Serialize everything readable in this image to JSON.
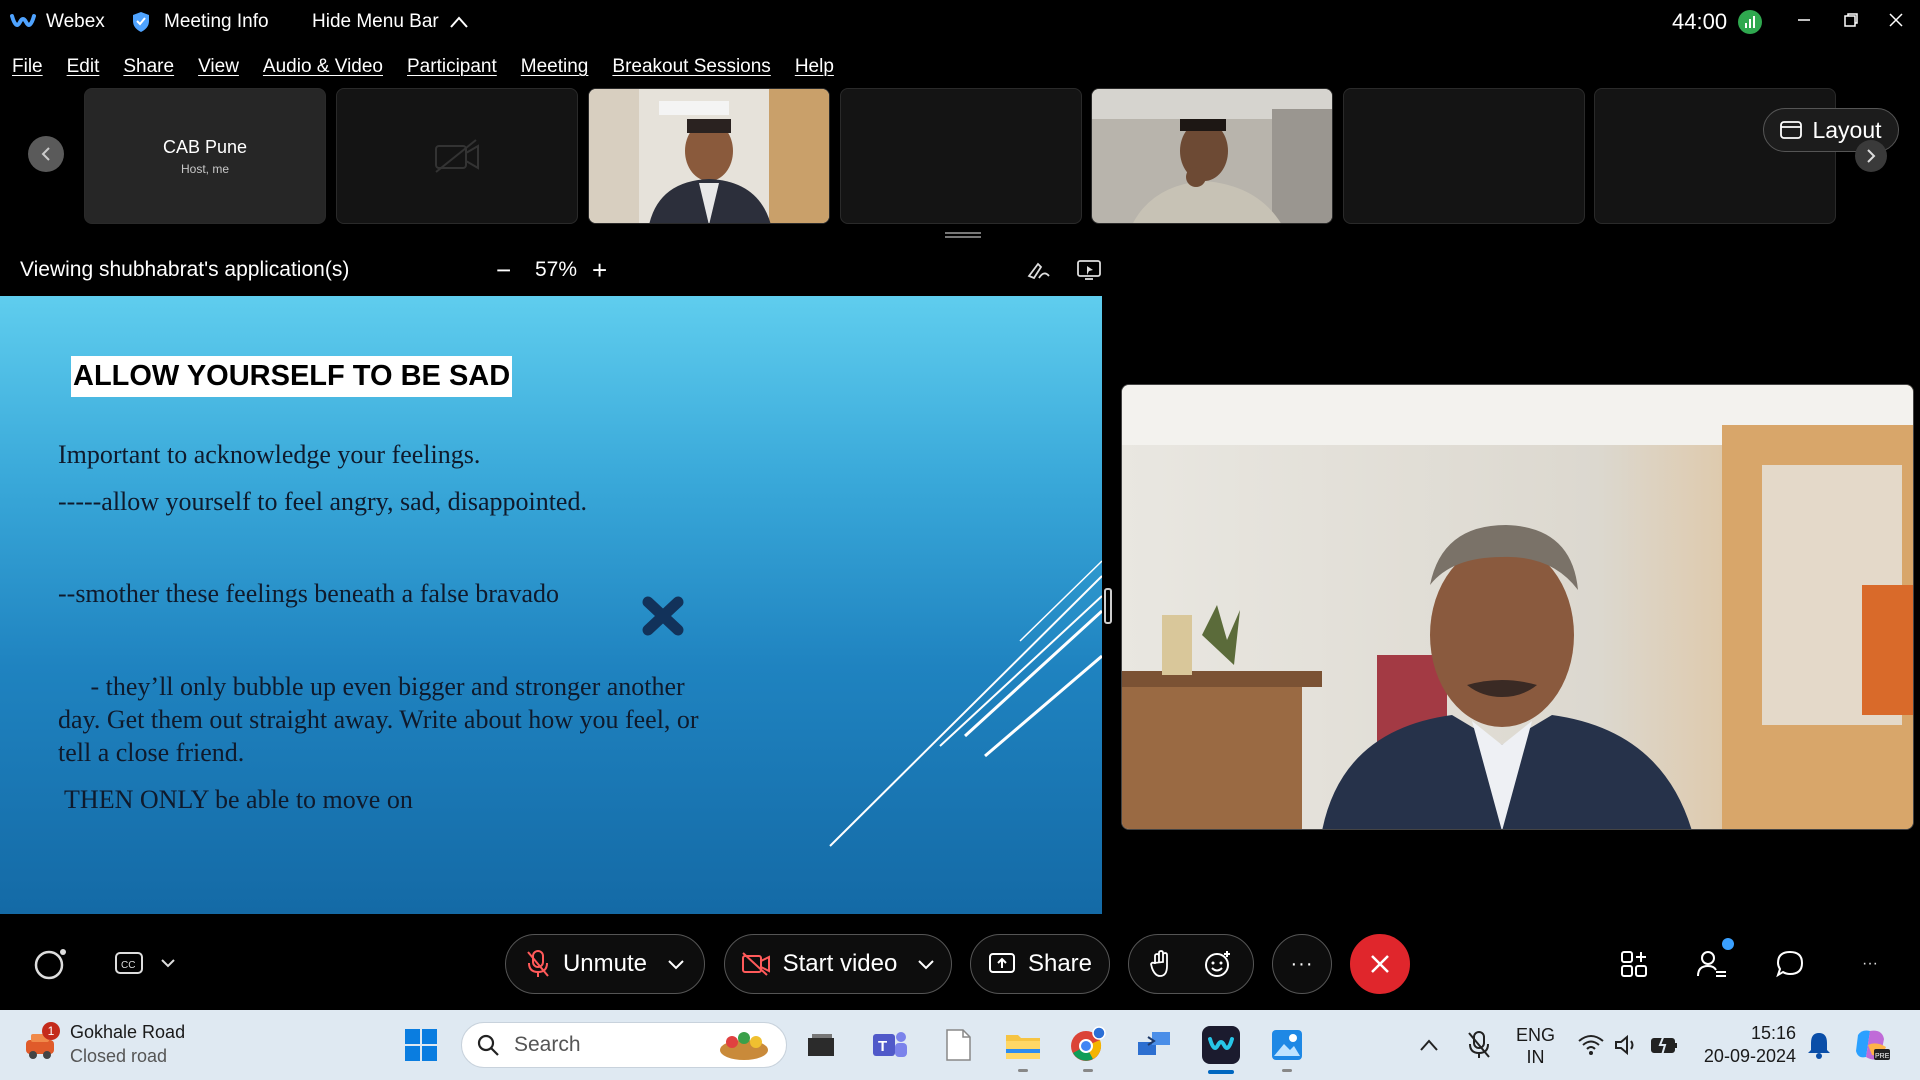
{
  "titlebar": {
    "app_name": "Webex",
    "meeting_info": "Meeting Info",
    "hide_menu": "Hide Menu Bar",
    "timer": "44:00"
  },
  "menu": {
    "items": [
      "File",
      "Edit",
      "Share",
      "View",
      "Audio & Video",
      "Participant",
      "Meeting",
      "Breakout Sessions",
      "Help"
    ]
  },
  "participants": {
    "host_name": "CAB Pune",
    "host_sub": "Host, me",
    "layout_label": "Layout"
  },
  "viewing": {
    "label": "Viewing shubhabrat's application(s)",
    "zoom_minus": "−",
    "zoom": "57%",
    "zoom_plus": "+"
  },
  "slide": {
    "title": "ALLOW YOURSELF TO BE SAD",
    "line1": "Important to acknowledge your feelings.",
    "line2": "-----allow yourself to feel angry, sad, disappointed.",
    "line3": "--smother these feelings beneath a false bravado",
    "line4": "     - they’ll only bubble up even bigger and stronger another",
    "line5": "day. Get them out straight away. Write about how you feel, or",
    "line6": "tell a close friend.",
    "line7": " THEN ONLY be able to move on"
  },
  "controls": {
    "unmute": "Unmute",
    "start_video": "Start video",
    "share": "Share",
    "more": "···"
  },
  "taskbar": {
    "weather_title": "Gokhale Road",
    "weather_sub": "Closed road",
    "weather_badge": "1",
    "search_placeholder": "Search",
    "lang1": "ENG",
    "lang2": "IN",
    "time": "15:16",
    "date": "20-09-2024"
  },
  "colors": {
    "end_call": "#e0262c",
    "accent_blue": "#0067c0",
    "signal_green": "#2fa84f"
  }
}
